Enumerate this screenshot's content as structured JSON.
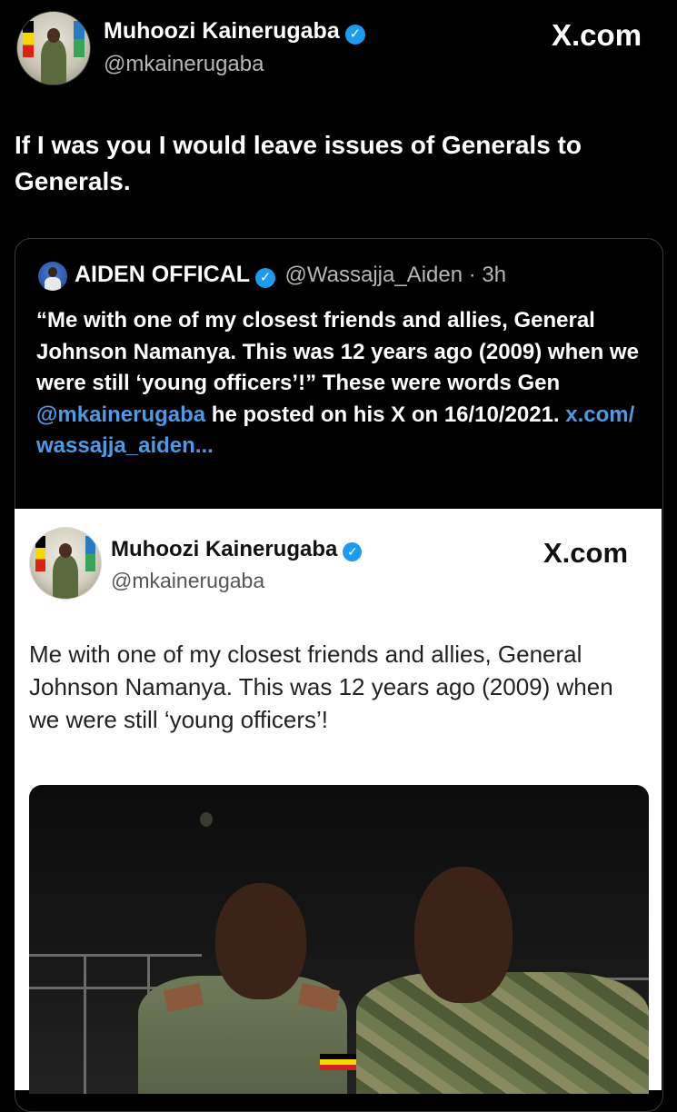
{
  "tweet": {
    "author_name": "Muhoozi Kainerugaba",
    "author_handle": "@mkainerugaba",
    "site_label": "X.com",
    "text": "If I was you I would leave issues of Generals to Generals."
  },
  "quote": {
    "author_name": "AIDEN OFFICAL",
    "author_handle": "@Wassajja_Aiden",
    "time": "3h",
    "text_part1": "“Me with one of my closest friends and allies, General Johnson Namanya. This was 12 years ago (2009) when we were still ‘young officers’!” These were words Gen ",
    "mention": "@mkainerugaba",
    "text_part2": " he posted on his X on 16/10/2021. ",
    "link": "x.com/ wassajja_aiden..."
  },
  "embedded": {
    "author_name": "Muhoozi Kainerugaba",
    "author_handle": "@mkainerugaba",
    "site_label": "X.com",
    "text": "Me with one of my closest friends and allies, General Johnson Namanya. This was 12 years ago (2009) when we were still ‘young officers’!"
  },
  "icons": {
    "verified": "verified-badge-icon"
  },
  "colors": {
    "background": "#000000",
    "link": "#4d9ae6",
    "verified": "#1d9bf0",
    "embed_background": "#ffffff"
  }
}
